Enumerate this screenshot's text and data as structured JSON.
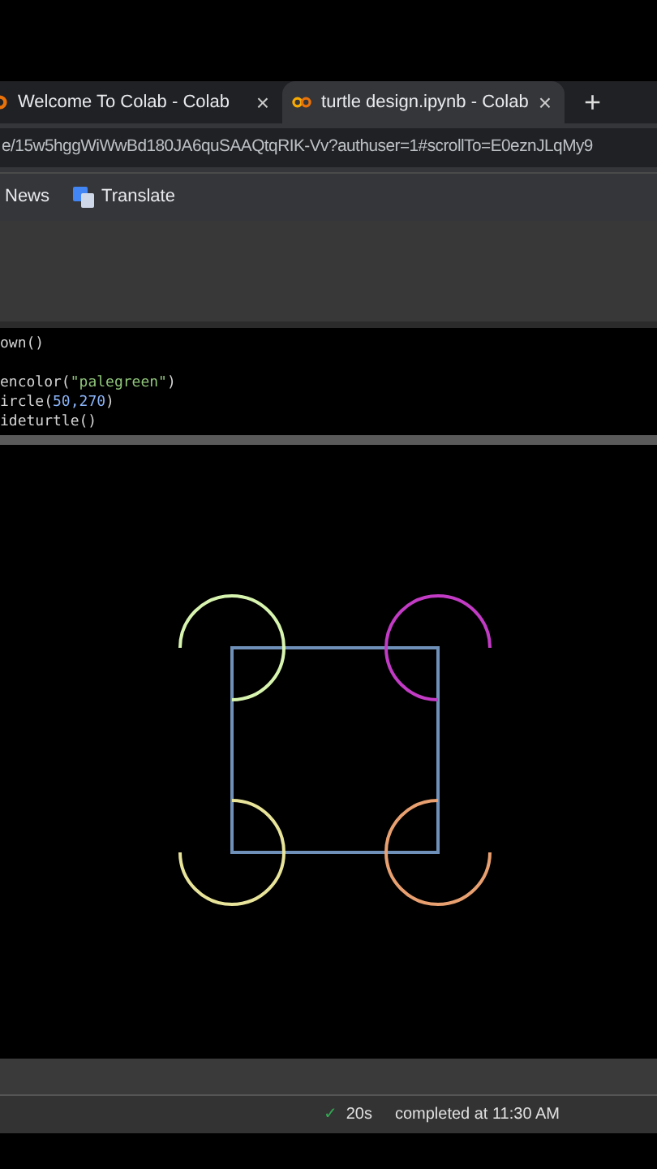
{
  "tabs": [
    {
      "title": "Welcome To Colab - Colab",
      "close": "×",
      "selected": false
    },
    {
      "title": "turtle design.ipynb - Colab",
      "close": "×",
      "selected": true
    }
  ],
  "new_tab": "+",
  "address_bar": {
    "value": "e/15w5hggWiWwBd180JA6quSAAQtqRIK-Vv?authuser=1#scrollTo=E0eznJLqMy9"
  },
  "bookmarks": [
    {
      "label": "News",
      "kind": "plain"
    },
    {
      "label": "Translate",
      "kind": "translate"
    }
  ],
  "code_lines": [
    {
      "tokens": [
        {
          "text": "own()",
          "kind": "plain"
        }
      ]
    },
    {
      "tokens": [
        {
          "text": "encolor(",
          "kind": "plain"
        },
        {
          "text": "\"palegreen\"",
          "kind": "string"
        },
        {
          "text": ")",
          "kind": "plain"
        }
      ]
    },
    {
      "tokens": [
        {
          "text": "ircle(",
          "kind": "plain"
        },
        {
          "text": "50,270",
          "kind": "number"
        },
        {
          "text": ")",
          "kind": "plain"
        }
      ]
    },
    {
      "tokens": [
        {
          "text": "ideturtle()",
          "kind": "plain"
        }
      ]
    }
  ],
  "status_bar": {
    "check": "✓",
    "duration": "20s",
    "message": "completed at 11:30 AM"
  }
}
